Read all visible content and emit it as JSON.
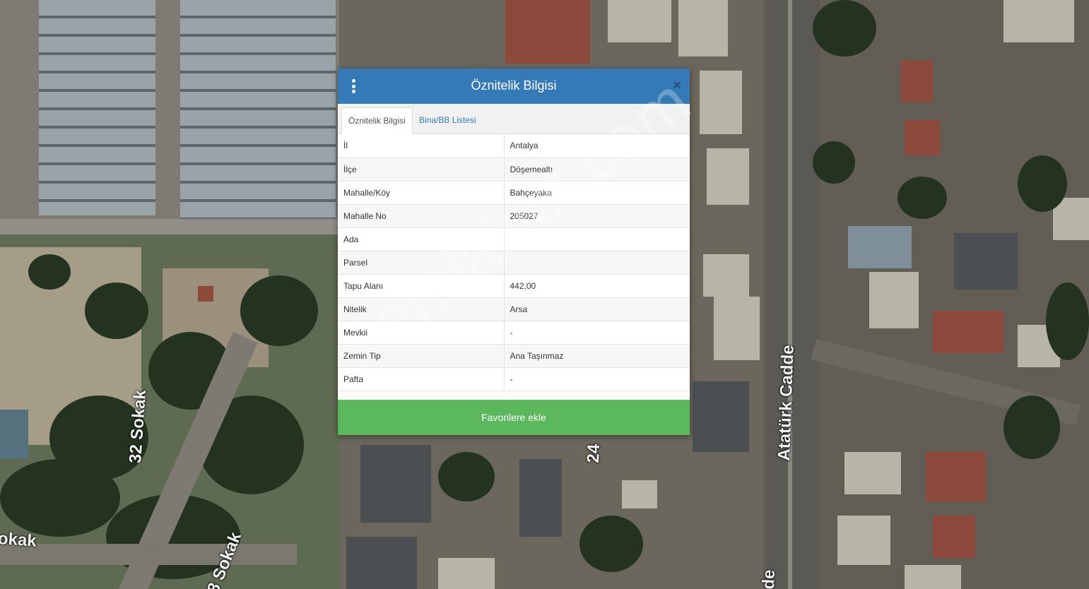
{
  "dialog": {
    "title": "Öznitelik Bilgisi",
    "tabs": [
      {
        "label": "Öznitelik Bilgisi",
        "active": true
      },
      {
        "label": "Bina/BB Listesi",
        "active": false
      }
    ],
    "rows": [
      {
        "key": "İl",
        "value": "Antalya"
      },
      {
        "key": "İlçe",
        "value": "Döşemealtı"
      },
      {
        "key": "Mahalle/Köy",
        "value": "Bahçeyaka"
      },
      {
        "key": "Mahalle No",
        "value": "205027"
      },
      {
        "key": "Ada",
        "value": ""
      },
      {
        "key": "Parsel",
        "value": ""
      },
      {
        "key": "Tapu Alanı",
        "value": "442,00"
      },
      {
        "key": "Nitelik",
        "value": "Arsa"
      },
      {
        "key": "Mevkii",
        "value": "-"
      },
      {
        "key": "Zemin Tip",
        "value": "Ana Taşınmaz"
      },
      {
        "key": "Pafta",
        "value": "-"
      }
    ],
    "favorite_button": "Favorilere ekle"
  },
  "map": {
    "labels": [
      "32 Sokak",
      "Atatürk Cadde",
      "okak",
      "8 Sokak",
      "24",
      "de"
    ]
  },
  "watermark": "emlakjet.com",
  "colors": {
    "header": "#337ab7",
    "favorite_button": "#5cb85c",
    "tab_link": "#337ab7"
  }
}
